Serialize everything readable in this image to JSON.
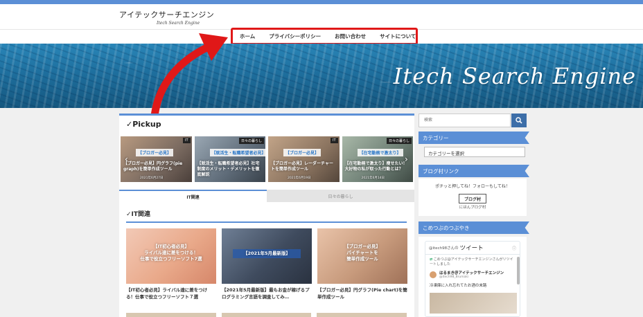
{
  "site": {
    "logo_main": "アイテックサーチエンジン",
    "logo_sub": "Itech Search Engine",
    "hero_title": "Itech Search Engine"
  },
  "nav": {
    "items": [
      {
        "label": "ホーム"
      },
      {
        "label": "プライバシーポリシー"
      },
      {
        "label": "お問い合わせ"
      },
      {
        "label": "サイトについて"
      }
    ]
  },
  "pickup": {
    "title": "✓Pickup",
    "slides": [
      {
        "tag": "IT",
        "banner": "【ブロガー必見】",
        "text": "【ブロガー必見】円グラフ(pie graph)を簡単作成ツール",
        "date": "2021年6月27日"
      },
      {
        "tag": "日々の暮らし",
        "banner": "【就活生・転職希望者必見】",
        "text": "【就活生・転職希望者必見】社宅制度のメリット・デメリットを徹底解説",
        "date": ""
      },
      {
        "tag": "IT",
        "banner": "【ブロガー必見】",
        "text": "【ブロガー必見】レーダーチャートを簡単作成ツール",
        "date": "2021年6月19日"
      },
      {
        "tag": "日々の暮らし",
        "banner": "【在宅勤務で激太り】",
        "text": "【在宅勤務で激太り】痩せたい！大好物の私が取った行動とは？",
        "date": "2021年6月14日"
      }
    ]
  },
  "tabs": {
    "it": "IT関連",
    "daily": "日々の暮らし"
  },
  "it_section": {
    "title": "✓IT関連",
    "cards": [
      {
        "image_text": "【IT初心者必見】\nライバル達に差をつける！\n仕事で役立つフリーソフト7選",
        "title": "【IT初心者必見】ライバル達に差をつける！仕事で役立つフリーソフト７選"
      },
      {
        "image_text": "【2021年5月最新版】",
        "title": "【2021年5月最新版】最もお金が稼げるプログラミング言語を調査してみ…"
      },
      {
        "image_text": "【ブロガー必見】\nパイチャートを\n簡単作成ツール",
        "title": "【ブロガー必見】円グラフ(Pie chart)を簡単作成ツール"
      }
    ]
  },
  "sidebar": {
    "search_placeholder": "検索",
    "category_head": "カテゴリー",
    "category_select": "カテゴリーを選択",
    "blogmura_head": "ブログ村リンク",
    "blogmura_text": "ポチッと押してね！フォローもしてね！",
    "blogmura_badge": "ブログ村",
    "blogmura_caption": "にほんブログ村",
    "tweets_head": "こめつぶのつぶやき",
    "tw_user": "@itech98さんの",
    "tw_label": "ツイート",
    "tw_retweet": "こめつぶ@アイテックサーチエンジンさんがリツイートしました",
    "tw_name": "はるまき＠アイテックサーチエンジン",
    "tw_handle": "@itech98_8rumaki",
    "tw_body": "冷凍庫に入れ忘れてたお酒の末路"
  },
  "colors": {
    "accent": "#5b8fd6",
    "highlight": "#e01818"
  }
}
